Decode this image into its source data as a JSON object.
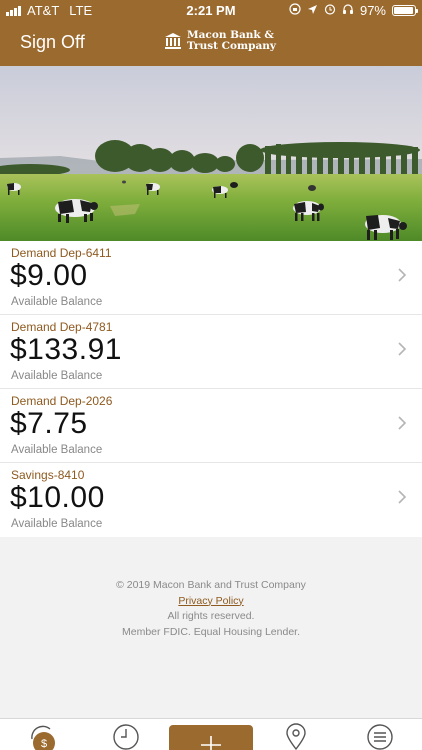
{
  "status_bar": {
    "carrier": "AT&T",
    "network": "LTE",
    "time": "2:21 PM",
    "battery": "97%"
  },
  "header": {
    "sign_off_label": "Sign Off",
    "logo_line1": "Macon Bank &",
    "logo_line2": "Trust Company"
  },
  "accounts": [
    {
      "name": "Demand Dep-6411",
      "balance": "$9.00",
      "label": "Available Balance"
    },
    {
      "name": "Demand Dep-4781",
      "balance": "$133.91",
      "label": "Available Balance"
    },
    {
      "name": "Demand Dep-2026",
      "balance": "$7.75",
      "label": "Available Balance"
    },
    {
      "name": "Savings-8410",
      "balance": "$10.00",
      "label": "Available Balance"
    }
  ],
  "footer": {
    "copyright": "© 2019 Macon Bank and Trust Company",
    "privacy": "Privacy Policy",
    "rights": "All rights reserved.",
    "fdic": "Member FDIC. Equal Housing Lender."
  },
  "tabbar": {
    "items": [
      "accounts-icon",
      "history-icon",
      "plus-icon",
      "location-icon",
      "menu-icon"
    ]
  },
  "colors": {
    "brand": "#9b6a2f",
    "account_name": "#8e5a1f"
  }
}
